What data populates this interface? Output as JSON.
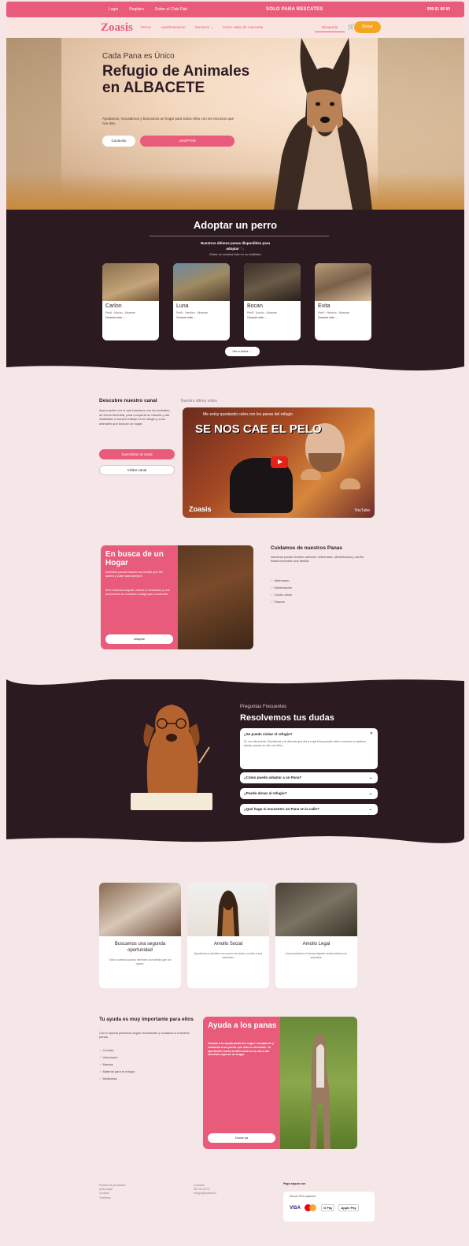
{
  "topbar": {
    "links": [
      "Login",
      "Registro",
      "Sobre el Club Flak"
    ],
    "promo": "SOLO PARA RESCATES",
    "phone": "999 61 89 99"
  },
  "nav": {
    "logo": "Zoasis",
    "links": [
      "Perros",
      "Apadrinamiento",
      "Servicios ⌄",
      "Cómo saber de mascotas"
    ],
    "search_label": "Búsqueda",
    "donate_label": "Donar"
  },
  "hero": {
    "kicker": "Cada Pana es Único",
    "title": "Refugio de Animales en ALBACETE",
    "subtitle": "Ayudamos, rescatamos y buscamos un hogar para todos ellos con los recursos que nos dan.",
    "btn_secondary": "Conócelo",
    "btn_primary": "ADOPTAR"
  },
  "adopt": {
    "title": "Adoptar un perro",
    "subtitle_1": "Nuestros últimos panas disponibles para",
    "subtitle_2": "adoptar 🐾",
    "subtitle_3": "Estas es nuestra lista en su totalidad",
    "cards": [
      {
        "name": "Carlon",
        "desc": "Perfil · Macho · Albacete",
        "more": "Conocer más →"
      },
      {
        "name": "Luna",
        "desc": "Perfil · Hembra · Albacete",
        "more": "Conocer más →"
      },
      {
        "name": "Bocan",
        "desc": "Perfil · Macho · Albacete",
        "more": "Conocer más →"
      },
      {
        "name": "Evita",
        "desc": "Perfil · Hembra · Albacete",
        "more": "Conocer más →"
      }
    ],
    "all_button": "Ver a todos →"
  },
  "canal": {
    "title": "Descubre nuestro canal",
    "tag": "Nuestro último vídeo",
    "text": "Aquí puedes ver lo que hacemos con los animales, de forma divertida, para compartir su historia y dar visibilidad a nuestro trabajo en el refugio y a los animales que buscan un hogar.",
    "btn_primary": "Suscribirse al canal",
    "btn_secondary": "Visitar canal",
    "video_title": "Me estoy quedando calvo con los panas del refugio",
    "video_big": "SE NOS CAE EL PELO",
    "video_brand": "Zoasis",
    "video_platform": "YouTube"
  },
  "busca": {
    "title": "En busca de un Hogar",
    "text_1": "Nuestros panas buscan una familia que les quiera y cuide para siempre.",
    "text_2": "Si te interesa adoptar, rellena el formulario y nos pondremos en contacto contigo para conocerte.",
    "button": "Adoptar"
  },
  "cuidamos": {
    "title": "Cuidamos de nuestros Panas",
    "text": "Nuestros panas reciben atención veterinaria, alimentación y cariño hasta encontrar una familia.",
    "list": [
      "Veterinario",
      "Alimentación",
      "Cariño diario",
      "Paseos"
    ]
  },
  "faq": {
    "kicker": "Preguntas Frecuentes",
    "title": "Resolvemos tus dudas",
    "open_q": "¿Se puede visitar el refugio?",
    "open_a": "Sí, con cita previa. Escríbenos y te diremos qué día y a qué hora puedes venir a conocer a nuestros panas y pasar un rato con ellos.",
    "items": [
      "¿Cómo puedo adoptar a un Pana?",
      "¿Puedo donar al refugio?",
      "¿Qué hago si encuentro un Pana en la calle?"
    ]
  },
  "services": [
    {
      "title": "Buscamos una segunda oportunidad",
      "desc": "Todos nuestros panas merecen una familia que los quiera."
    },
    {
      "title": "Amollo Social",
      "desc": "Ayudamos a familias con pocos recursos a cuidar a sus mascotas."
    },
    {
      "title": "Amollo Legal",
      "desc": "Asesoramiento en temas legales relacionados con animales."
    }
  ],
  "ayuda": {
    "title": "Tu ayuda es muy importante para ellos",
    "text": "Con tu ayuda podemos seguir rescatando y cuidando a nuestros panas.",
    "list": [
      "Comida",
      "Veterinario",
      "Mantas",
      "Material para el refugio",
      "Medicinas"
    ]
  },
  "help_card": {
    "title": "Ayuda a los panas",
    "text": "Gracias a tu ayuda podemos seguir rescatando y cuidando a los panas que más lo necesitan. Tu aportación marca la diferencia en su día a día mientras esperan un hogar.",
    "button": "Donar ya"
  },
  "footer": {
    "col1": [
      "Política de privacidad",
      "Aviso legal",
      "Cookies",
      "Términos"
    ],
    "col2": [
      "Contacto",
      "967 00 00 00",
      "refugio@zoasis.es"
    ],
    "pay_title": "Pago seguro con",
    "ssl": "Secure SSL payment",
    "cards": [
      "VISA",
      "Mastercard",
      "G Pay",
      "Apple Pay"
    ]
  },
  "colors": {
    "primary": "#e85b7a",
    "dark": "#2b1a20",
    "accent": "#f5a524",
    "bg": "#f5e6e8"
  }
}
